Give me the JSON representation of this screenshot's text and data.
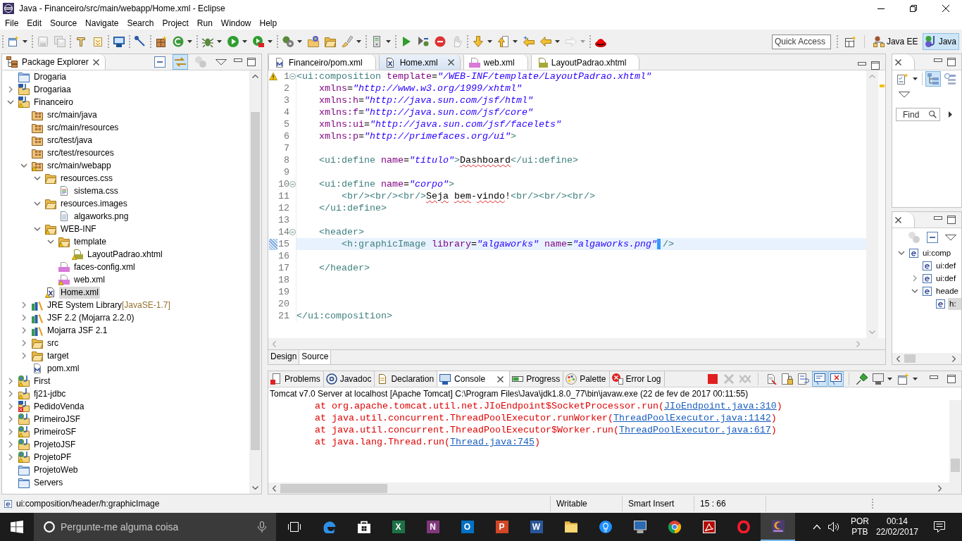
{
  "window": {
    "title": "Java - Financeiro/src/main/webapp/Home.xml - Eclipse"
  },
  "menu": [
    "File",
    "Edit",
    "Source",
    "Navigate",
    "Search",
    "Project",
    "Run",
    "Window",
    "Help"
  ],
  "toolbar": {
    "groups": [
      {
        "buttons": [
          {
            "kind": "new",
            "menu": true,
            "disabled": false
          }
        ]
      },
      {
        "buttons": [
          {
            "kind": "save",
            "disabled": true
          },
          {
            "kind": "saveall",
            "disabled": true
          }
        ]
      },
      {
        "buttons": [
          {
            "kind": "type",
            "disabled": false
          },
          {
            "kind": "resource",
            "disabled": false
          }
        ]
      },
      {
        "buttons": [
          {
            "kind": "monitor",
            "disabled": false
          }
        ]
      },
      {
        "buttons": [
          {
            "kind": "pen",
            "disabled": false
          }
        ]
      },
      {
        "buttons": [
          {
            "kind": "box",
            "disabled": false
          },
          {
            "kind": "class",
            "menu": true,
            "disabled": false
          }
        ]
      },
      {
        "buttons": [
          {
            "kind": "bug",
            "menu": true,
            "disabled": false
          },
          {
            "kind": "play",
            "menu": true,
            "disabled": false
          },
          {
            "kind": "tools",
            "menu": true,
            "disabled": false
          }
        ]
      },
      {
        "buttons": [
          {
            "kind": "gears",
            "menu": true,
            "disabled": false
          },
          {
            "kind": "folder-globe",
            "disabled": false
          },
          {
            "kind": "folder",
            "disabled": false
          },
          {
            "kind": "brush",
            "menu": true,
            "disabled": false
          }
        ]
      },
      {
        "buttons": [
          {
            "kind": "server",
            "menu": true,
            "disabled": false
          }
        ]
      },
      {
        "buttons": [
          {
            "kind": "resume",
            "disabled": false
          },
          {
            "kind": "step",
            "disabled": false
          },
          {
            "kind": "stop",
            "disabled": false
          },
          {
            "kind": "hand",
            "disabled": true
          }
        ]
      },
      {
        "buttons": [
          {
            "kind": "down",
            "menu": true,
            "disabled": false
          },
          {
            "kind": "up",
            "menu": true,
            "disabled": false
          },
          {
            "kind": "back-star",
            "disabled": false
          },
          {
            "kind": "back",
            "menu": true,
            "disabled": false
          },
          {
            "kind": "forward",
            "menu": true,
            "disabled": true
          }
        ]
      },
      {
        "buttons": [
          {
            "kind": "hat",
            "disabled": false
          }
        ]
      }
    ],
    "quick_access": {
      "placeholder": "Quick Access"
    },
    "perspectives": [
      {
        "label": "Java EE",
        "kind": "javaee",
        "selected": false
      },
      {
        "label": "Java",
        "kind": "java",
        "selected": true
      }
    ]
  },
  "package_explorer": {
    "title": "Package Explorer",
    "toolbar": [
      {
        "kind": "collapse",
        "pressed": false,
        "disabled": false
      },
      {
        "kind": "link",
        "pressed": true,
        "disabled": false
      },
      {
        "kind": "focus",
        "pressed": false,
        "disabled": true
      },
      {
        "kind": "view-menu",
        "pressed": false,
        "disabled": false
      }
    ],
    "items": [
      {
        "label": "Drogaria",
        "kind": "closed-project",
        "selected": false
      },
      {
        "label": "Drogariaa",
        "kind": "maven-project",
        "expanded": false,
        "selected": false
      },
      {
        "label": "Financeiro",
        "kind": "maven-project",
        "warning": true,
        "expanded": true,
        "selected": false,
        "children": [
          {
            "label": "src/main/java",
            "kind": "source-folder",
            "selected": false
          },
          {
            "label": "src/main/resources",
            "kind": "source-folder",
            "selected": false
          },
          {
            "label": "src/test/java",
            "kind": "source-folder",
            "selected": false
          },
          {
            "label": "src/test/resources",
            "kind": "source-folder",
            "selected": false
          },
          {
            "label": "src/main/webapp",
            "kind": "source-folder",
            "warning": true,
            "expanded": true,
            "selected": false,
            "children": [
              {
                "label": "resources.css",
                "kind": "folder",
                "expanded": true,
                "selected": false,
                "children": [
                  {
                    "label": "sistema.css",
                    "kind": "css-file",
                    "selected": false
                  }
                ]
              },
              {
                "label": "resources.images",
                "kind": "folder",
                "expanded": true,
                "selected": false,
                "children": [
                  {
                    "label": "algaworks.png",
                    "kind": "file",
                    "selected": false
                  }
                ]
              },
              {
                "label": "WEB-INF",
                "kind": "folder",
                "warning": true,
                "expanded": true,
                "selected": false,
                "children": [
                  {
                    "label": "template",
                    "kind": "folder",
                    "warning": true,
                    "expanded": true,
                    "selected": false,
                    "children": [
                      {
                        "label": "LayoutPadrao.xhtml",
                        "kind": "html-file",
                        "warning": true,
                        "selected": false
                      }
                    ]
                  },
                  {
                    "label": "faces-config.xml",
                    "kind": "xml-file",
                    "selected": false
                  },
                  {
                    "label": "web.xml",
                    "kind": "xml-file",
                    "warning": true,
                    "selected": false
                  }
                ]
              },
              {
                "label": "Home.xml",
                "kind": "x-file",
                "warning": true,
                "selected": true
              }
            ]
          },
          {
            "label": "JRE System Library",
            "decoration": "[JavaSE-1.7]",
            "kind": "library",
            "expanded": false,
            "selected": false
          },
          {
            "label": "JSF 2.2 (Mojarra 2.2.0)",
            "kind": "library",
            "expanded": false,
            "selected": false
          },
          {
            "label": "Mojarra JSF 2.1",
            "kind": "library",
            "expanded": false,
            "selected": false
          },
          {
            "label": "src",
            "kind": "folder",
            "expanded": false,
            "selected": false
          },
          {
            "label": "target",
            "kind": "folder",
            "expanded": false,
            "selected": false
          },
          {
            "label": "pom.xml",
            "kind": "maven-file",
            "selected": false
          }
        ]
      },
      {
        "label": "First",
        "kind": "web-project",
        "warning": true,
        "expanded": false,
        "selected": false
      },
      {
        "label": "fj21-jdbc",
        "kind": "java-project",
        "warning": true,
        "expanded": false,
        "selected": false
      },
      {
        "label": "PedidoVenda",
        "kind": "maven-project",
        "error": true,
        "expanded": false,
        "selected": false
      },
      {
        "label": "PrimeiroJSF",
        "kind": "web-project",
        "expanded": false,
        "selected": false
      },
      {
        "label": "PrimeiroSF",
        "kind": "web-project",
        "warning": true,
        "expanded": false,
        "selected": false
      },
      {
        "label": "ProjetoJSF",
        "kind": "web-project",
        "expanded": false,
        "selected": false
      },
      {
        "label": "ProjetoPF",
        "kind": "web-project",
        "warning": true,
        "expanded": false,
        "selected": false
      },
      {
        "label": "ProjetoWeb",
        "kind": "closed-project",
        "selected": false
      },
      {
        "label": "Servers",
        "kind": "closed-project",
        "selected": false
      }
    ]
  },
  "editor": {
    "tabs": [
      {
        "label": "Financeiro/pom.xml",
        "kind": "maven-file",
        "selected": false
      },
      {
        "label": "Home.xml",
        "kind": "x-file",
        "selected": true
      },
      {
        "label": "web.xml",
        "kind": "xml-file",
        "selected": false
      },
      {
        "label": "LayoutPadrao.xhtml",
        "kind": "html-file",
        "selected": false
      }
    ],
    "lines": [
      {
        "number": "1",
        "fold": true,
        "current": false,
        "warning": true,
        "segments": [
          {
            "kind": "tag",
            "text": "<ui:composition"
          },
          {
            "kind": "attr",
            "text": " template"
          },
          {
            "kind": "eq",
            "text": "="
          },
          {
            "kind": "value",
            "text": "\"/WEB-INF/template/LayoutPadrao.xhtml\""
          }
        ]
      },
      {
        "number": "2",
        "fold": false,
        "current": false,
        "segments": [
          {
            "kind": "attr",
            "text": "    xmlns"
          },
          {
            "kind": "eq",
            "text": "="
          },
          {
            "kind": "value",
            "text": "\"http://www.w3.org/1999/xhtml\""
          }
        ]
      },
      {
        "number": "3",
        "fold": false,
        "current": false,
        "segments": [
          {
            "kind": "attr",
            "text": "    xmlns:h"
          },
          {
            "kind": "eq",
            "text": "="
          },
          {
            "kind": "value",
            "text": "\"http://java.sun.com/jsf/html\""
          }
        ]
      },
      {
        "number": "4",
        "fold": false,
        "current": false,
        "segments": [
          {
            "kind": "attr",
            "text": "    xmlns:f"
          },
          {
            "kind": "eq",
            "text": "="
          },
          {
            "kind": "value",
            "text": "\"http://java.sun.com/jsf/core\""
          }
        ]
      },
      {
        "number": "5",
        "fold": false,
        "current": false,
        "segments": [
          {
            "kind": "attr",
            "text": "    xmlns:ui"
          },
          {
            "kind": "eq",
            "text": "="
          },
          {
            "kind": "value",
            "text": "\"http://java.sun.com/jsf/facelets\""
          }
        ]
      },
      {
        "number": "6",
        "fold": false,
        "current": false,
        "segments": [
          {
            "kind": "attr",
            "text": "    xmlns:p"
          },
          {
            "kind": "eq",
            "text": "="
          },
          {
            "kind": "value",
            "text": "\"http://primefaces.org/ui\""
          },
          {
            "kind": "tag",
            "text": ">"
          }
        ]
      },
      {
        "number": "7",
        "fold": false,
        "current": false
      },
      {
        "number": "8",
        "fold": false,
        "current": false,
        "segments": [
          {
            "kind": "tag",
            "text": "    <ui:define"
          },
          {
            "kind": "attr",
            "text": " name"
          },
          {
            "kind": "eq",
            "text": "="
          },
          {
            "kind": "value",
            "text": "\"titulo\""
          },
          {
            "kind": "tag",
            "text": ">"
          },
          {
            "kind": "misspelled",
            "text": "Dashboard"
          },
          {
            "kind": "tag",
            "text": "</ui:define>"
          }
        ]
      },
      {
        "number": "9",
        "fold": false,
        "current": false
      },
      {
        "number": "10",
        "fold": true,
        "current": false,
        "segments": [
          {
            "kind": "tag",
            "text": "    <ui:define"
          },
          {
            "kind": "attr",
            "text": " name"
          },
          {
            "kind": "eq",
            "text": "="
          },
          {
            "kind": "value",
            "text": "\"corpo\""
          },
          {
            "kind": "tag",
            "text": ">"
          }
        ]
      },
      {
        "number": "11",
        "fold": false,
        "current": false,
        "segments": [
          {
            "kind": "tag",
            "text": "        <br/><br/><br/>"
          },
          {
            "kind": "misspelled",
            "text": "Seja"
          },
          {
            "kind": "misspelled",
            "text": " bem"
          },
          {
            "kind": "text",
            "text": "-"
          },
          {
            "kind": "misspelled",
            "text": "vindo"
          },
          {
            "kind": "text",
            "text": "!"
          },
          {
            "kind": "tag",
            "text": "<br/><br/><br/>"
          }
        ]
      },
      {
        "number": "12",
        "fold": false,
        "current": false,
        "segments": [
          {
            "kind": "tag",
            "text": "    </ui:define>"
          }
        ]
      },
      {
        "number": "13",
        "fold": false,
        "current": false
      },
      {
        "number": "14",
        "fold": true,
        "current": false,
        "segments": [
          {
            "kind": "tag",
            "text": "    <header>"
          }
        ]
      },
      {
        "number": "15",
        "fold": false,
        "current": true,
        "occurrence": true,
        "segments": [
          {
            "kind": "tag",
            "text": "        <h:graphicImage"
          },
          {
            "kind": "attr",
            "text": " library"
          },
          {
            "kind": "eq",
            "text": "="
          },
          {
            "kind": "value",
            "text": "\"algaworks\""
          },
          {
            "kind": "attr",
            "text": " name"
          },
          {
            "kind": "eq",
            "text": "="
          },
          {
            "kind": "value",
            "text": "\"algaworks.png\"",
            "caret_after": true
          },
          {
            "kind": "tag",
            "text": " />"
          }
        ]
      },
      {
        "number": "16",
        "fold": false,
        "current": false
      },
      {
        "number": "17",
        "fold": false,
        "current": false,
        "segments": [
          {
            "kind": "tag",
            "text": "    </header>"
          }
        ]
      },
      {
        "number": "18",
        "fold": false,
        "current": false
      },
      {
        "number": "19",
        "fold": false,
        "current": false
      },
      {
        "number": "20",
        "fold": false,
        "current": false
      },
      {
        "number": "21",
        "fold": false,
        "current": false,
        "segments": [
          {
            "kind": "tag",
            "text": "</ui:composition>"
          }
        ]
      }
    ],
    "modes": [
      {
        "label": "Design",
        "selected": false
      },
      {
        "label": "Source",
        "selected": true
      }
    ]
  },
  "task_list": {
    "toolbar": [
      {
        "kind": "new-task",
        "menu": true,
        "pressed": false,
        "disabled": false
      },
      {
        "kind": "categories",
        "pressed": true,
        "disabled": false
      },
      {
        "kind": "hierarchy",
        "pressed": false,
        "disabled": false
      }
    ],
    "find": {
      "placeholder": "Find"
    }
  },
  "outline": {
    "toolbar": [
      {
        "kind": "focus",
        "pressed": false,
        "disabled": true
      },
      {
        "kind": "collapse",
        "pressed": false,
        "disabled": false
      },
      {
        "kind": "view-menu",
        "pressed": false,
        "disabled": false
      }
    ],
    "items": [
      {
        "label": "ui:comp",
        "expanded": true,
        "selected": false,
        "children": [
          {
            "label": "ui:def",
            "selected": false
          },
          {
            "label": "ui:def",
            "expanded": false,
            "selected": false
          },
          {
            "label": "heade",
            "expanded": true,
            "selected": false,
            "children": [
              {
                "label": "h:",
                "selected": true
              }
            ]
          }
        ]
      }
    ]
  },
  "console": {
    "tabs": [
      {
        "label": "Problems",
        "kind": "problems",
        "selected": false
      },
      {
        "label": "Javadoc",
        "kind": "javadoc",
        "selected": false
      },
      {
        "label": "Declaration",
        "kind": "declaration",
        "selected": false
      },
      {
        "label": "Console",
        "kind": "console",
        "selected": true
      },
      {
        "label": "Progress",
        "kind": "progress",
        "selected": false
      },
      {
        "label": "Palette",
        "kind": "palette",
        "selected": false
      },
      {
        "label": "Error Log",
        "kind": "error-log",
        "selected": false
      }
    ],
    "toolbar": [
      {
        "kind": "terminate",
        "pressed": false,
        "disabled": false
      },
      {
        "kind": "remove",
        "pressed": false,
        "disabled": true
      },
      {
        "kind": "remove-all",
        "pressed": false,
        "disabled": true
      },
      {
        "kind": "clear",
        "pressed": false,
        "disabled": false
      },
      {
        "kind": "scroll-lock",
        "pressed": false,
        "disabled": false
      },
      {
        "kind": "word-wrap",
        "pressed": false,
        "disabled": false
      },
      {
        "kind": "stdout",
        "pressed": true,
        "disabled": false
      },
      {
        "kind": "stderr",
        "pressed": true,
        "disabled": false
      },
      {
        "kind": "pin",
        "pressed": false,
        "disabled": false
      },
      {
        "kind": "display",
        "menu": true,
        "pressed": false,
        "disabled": false
      },
      {
        "kind": "open-console",
        "menu": true,
        "pressed": false,
        "disabled": false
      }
    ],
    "header": "Tomcat v7.0 Server at localhost [Apache Tomcat] C:\\Program Files\\Java\\jdk1.8.0_77\\bin\\javaw.exe (22 de fev de 2017 00:11:55)",
    "lines": [
      {
        "text": "at org.apache.tomcat.util.net.JIoEndpoint$SocketProcessor.run(",
        "link": "JIoEndpoint.java:310",
        "tail": ")"
      },
      {
        "text": "at java.util.concurrent.ThreadPoolExecutor.runWorker(",
        "link": "ThreadPoolExecutor.java:1142",
        "tail": ")"
      },
      {
        "text": "at java.util.concurrent.ThreadPoolExecutor$Worker.run(",
        "link": "ThreadPoolExecutor.java:617",
        "tail": ")"
      },
      {
        "text": "at java.lang.Thread.run(",
        "link": "Thread.java:745",
        "tail": ")"
      }
    ]
  },
  "status_bar": {
    "path": "ui:composition/header/h:graphicImage",
    "fields": [
      "Writable",
      "Smart Insert",
      "15 : 66"
    ]
  },
  "taskbar": {
    "search": {
      "placeholder": "Pergunte-me alguma coisa"
    },
    "apps": [
      {
        "kind": "edge",
        "selected": false
      },
      {
        "kind": "store",
        "selected": false
      },
      {
        "kind": "tile",
        "glyph": "X",
        "color": "#1e7145",
        "selected": false
      },
      {
        "kind": "tile",
        "glyph": "N",
        "color": "#80397b",
        "selected": false
      },
      {
        "kind": "tile",
        "glyph": "O",
        "color": "#0072c6",
        "selected": false
      },
      {
        "kind": "tile",
        "glyph": "P",
        "color": "#d24726",
        "selected": false
      },
      {
        "kind": "tile",
        "glyph": "W",
        "color": "#2b579a",
        "selected": false
      },
      {
        "kind": "folder",
        "selected": false
      },
      {
        "kind": "bulb",
        "selected": false
      },
      {
        "kind": "monitor",
        "selected": false
      },
      {
        "kind": "chrome",
        "selected": false
      },
      {
        "kind": "pdf",
        "selected": false
      },
      {
        "kind": "ring",
        "selected": false
      },
      {
        "kind": "eclipse",
        "selected": true
      }
    ],
    "tray": {
      "language": "POR",
      "layout": "PTB",
      "time": "00:14",
      "date": "22/02/2017"
    }
  }
}
